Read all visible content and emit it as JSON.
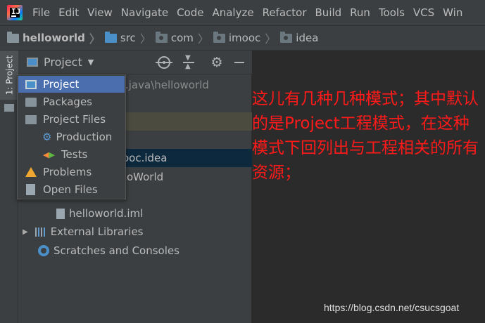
{
  "menu": [
    "File",
    "Edit",
    "View",
    "Navigate",
    "Code",
    "Analyze",
    "Refactor",
    "Build",
    "Run",
    "Tools",
    "VCS",
    "Win"
  ],
  "app_logo_text": "IJ",
  "breadcrumb": [
    {
      "label": "helloworld",
      "icon": "folder-icon"
    },
    {
      "label": "src",
      "icon": "source-folder-icon"
    },
    {
      "label": "com",
      "icon": "package-icon"
    },
    {
      "label": "imooc",
      "icon": "package-icon"
    },
    {
      "label": "idea",
      "icon": "package-icon"
    }
  ],
  "tool_window_tab": "1: Project",
  "panel": {
    "view_selector": "Project",
    "caret": "▼",
    "gear": "⚙"
  },
  "tree": {
    "row1_path": ".java\\helloworld",
    "row_selected": "ooc.idea",
    "row_class": "oWorld",
    "iml_file": "helloworld.iml",
    "external_libraries": "External Libraries",
    "scratches": "Scratches and Consoles"
  },
  "popup": {
    "items": [
      "Project",
      "Packages",
      "Project Files",
      "Production",
      "Tests",
      "Problems",
      "Open Files"
    ],
    "active": "Project"
  },
  "annotation": "这儿有几种几种模式；其中默认的是Project工程模式，在这种模式下回列出与工程相关的所有资源；",
  "watermark": "https://blog.csdn.net/csucsgoat",
  "colors": {
    "accent_selected": "#4b6eaf",
    "annotation_red": "#ff1a1a",
    "tree_selection": "#0d293e"
  }
}
